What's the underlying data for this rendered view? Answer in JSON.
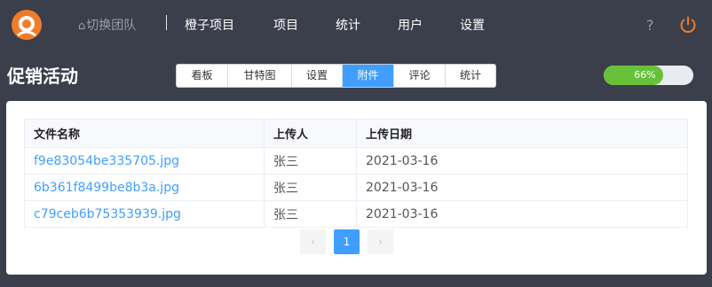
{
  "nav": {
    "team_switch": "切换团队",
    "items": [
      "橙子项目",
      "项目",
      "统计",
      "用户",
      "设置"
    ],
    "help": "?"
  },
  "page": {
    "title": "促销活动"
  },
  "tabs": [
    {
      "label": "看板",
      "active": false
    },
    {
      "label": "甘特图",
      "active": false
    },
    {
      "label": "设置",
      "active": false
    },
    {
      "label": "附件",
      "active": true
    },
    {
      "label": "评论",
      "active": false
    },
    {
      "label": "统计",
      "active": false
    }
  ],
  "progress": {
    "value": 66,
    "label": "66%",
    "color": "#67c23a"
  },
  "table": {
    "headers": [
      "文件名称",
      "上传人",
      "上传日期"
    ],
    "rows": [
      [
        "f9e83054be335705.jpg",
        "张三",
        "2021-03-16"
      ],
      [
        "6b361f8499be8b3a.jpg",
        "张三",
        "2021-03-16"
      ],
      [
        "c79ceb6b75353939.jpg",
        "张三",
        "2021-03-16"
      ]
    ]
  },
  "pagination": {
    "prev": "‹",
    "current": "1",
    "next": "›"
  },
  "colors": {
    "background": "#3b3e4b",
    "accent": "#409eff",
    "logo": "#f07c2a"
  }
}
